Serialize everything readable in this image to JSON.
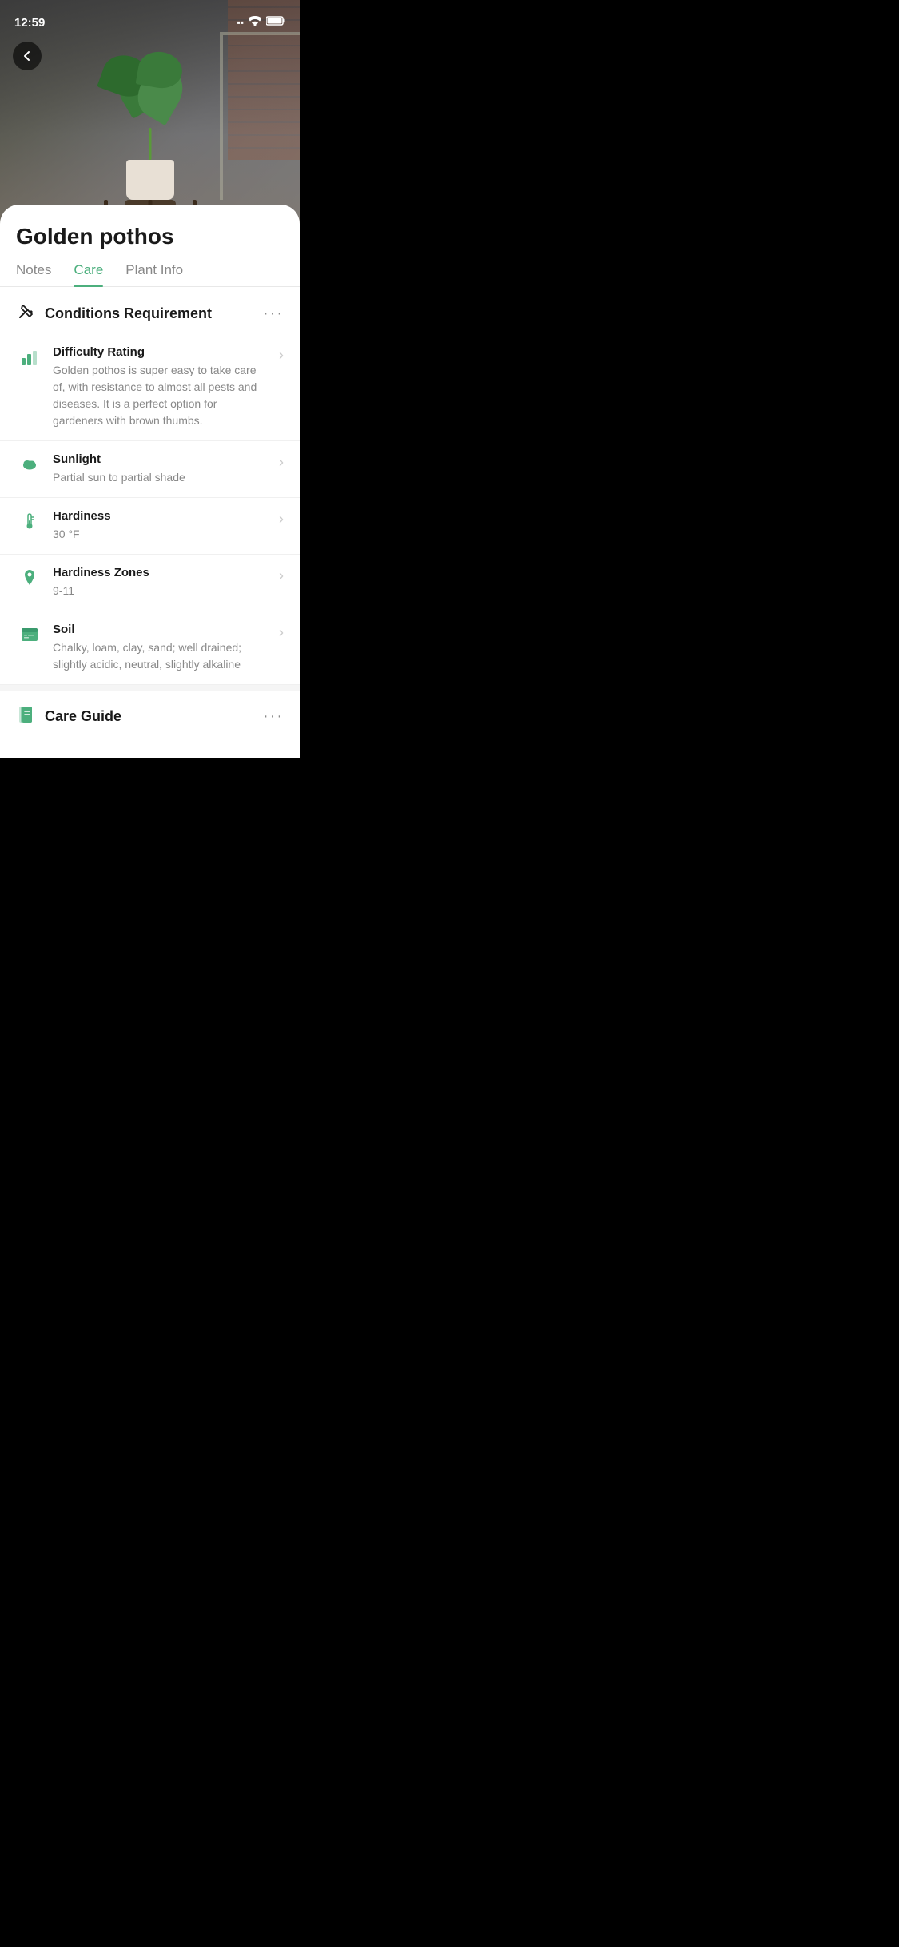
{
  "statusBar": {
    "time": "12:59",
    "signal": "▪▪",
    "wifi": "wifi",
    "battery": "battery"
  },
  "hero": {
    "altText": "Golden pothos plant on a windowsill"
  },
  "backButton": {
    "label": "‹"
  },
  "plantName": "Golden pothos",
  "tabs": [
    {
      "id": "notes",
      "label": "Notes",
      "active": false
    },
    {
      "id": "care",
      "label": "Care",
      "active": true
    },
    {
      "id": "plant-info",
      "label": "Plant Info",
      "active": false
    }
  ],
  "conditionsSection": {
    "title": "Conditions Requirement",
    "moreDots": "···",
    "items": [
      {
        "id": "difficulty",
        "title": "Difficulty Rating",
        "description": "Golden pothos is super easy to take care of, with resistance to almost all pests and diseases. It is a perfect option for gardeners with brown thumbs.",
        "hasArrow": true
      },
      {
        "id": "sunlight",
        "title": "Sunlight",
        "description": "Partial sun to partial shade",
        "hasArrow": true
      },
      {
        "id": "hardiness",
        "title": "Hardiness",
        "description": "30 °F",
        "hasArrow": true
      },
      {
        "id": "hardiness-zones",
        "title": "Hardiness Zones",
        "description": "9-11",
        "hasArrow": true
      },
      {
        "id": "soil",
        "title": "Soil",
        "description": "Chalky, loam, clay, sand; well drained; slightly acidic, neutral, slightly alkaline",
        "hasArrow": true
      }
    ]
  },
  "careGuideSection": {
    "title": "Care Guide",
    "moreDots": "···"
  },
  "colors": {
    "accent": "#4caf7d",
    "text": "#1a1a1a",
    "muted": "#888888",
    "divider": "#f0f0f0"
  }
}
